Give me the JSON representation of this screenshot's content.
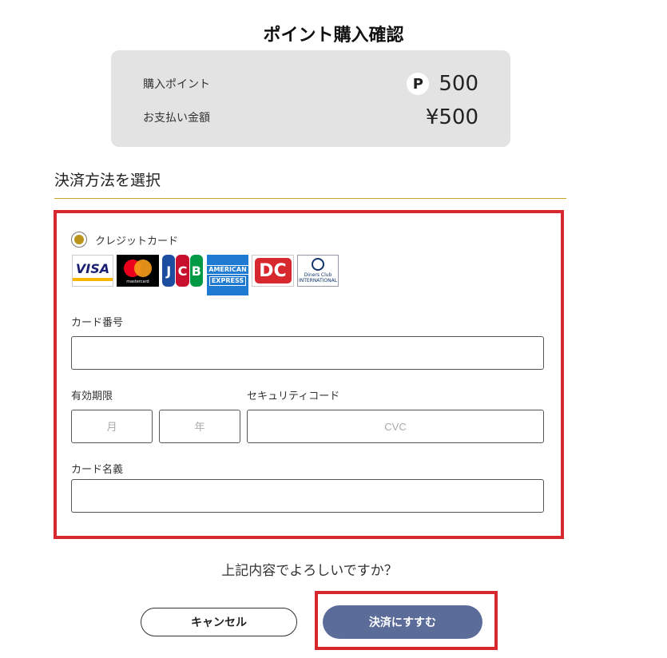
{
  "page": {
    "title": "ポイント購入確認"
  },
  "summary": {
    "purchase_points_label": "購入ポイント",
    "point_badge": "P",
    "purchase_points_value": "500",
    "payment_amount_label": "お支払い金額",
    "payment_amount_value": "¥500"
  },
  "payment_method": {
    "section_title": "決済方法を選択",
    "credit_card_label": "クレジットカード",
    "brands": [
      "visa-logo",
      "mastercard-logo",
      "jcb-logo",
      "amex-logo",
      "dc-logo",
      "diners-club-logo"
    ],
    "brand_texts": {
      "visa": "VISA",
      "mastercard": "mastercard",
      "jcb": [
        "J",
        "C",
        "B"
      ],
      "amex": [
        "AMERICAN",
        "EXPRESS"
      ],
      "dc": "DC",
      "diners": [
        "Diners Club",
        "INTERNATIONAL"
      ]
    }
  },
  "form": {
    "card_number_label": "カード番号",
    "card_number_value": "",
    "expiry_label": "有効期限",
    "month_placeholder": "月",
    "year_placeholder": "年",
    "security_code_label": "セキュリティコード",
    "cvc_placeholder": "CVC",
    "card_name_label": "カード名義",
    "card_name_value": ""
  },
  "confirm": {
    "question": "上記内容でよろしいですか？",
    "cancel_label": "キャンセル",
    "pay_label": "決済にすすむ"
  },
  "colors": {
    "accent_gold": "#c9a227",
    "highlight_red": "#d7282f",
    "pay_button": "#5b6c98",
    "summary_bg": "#e3e3e3"
  }
}
